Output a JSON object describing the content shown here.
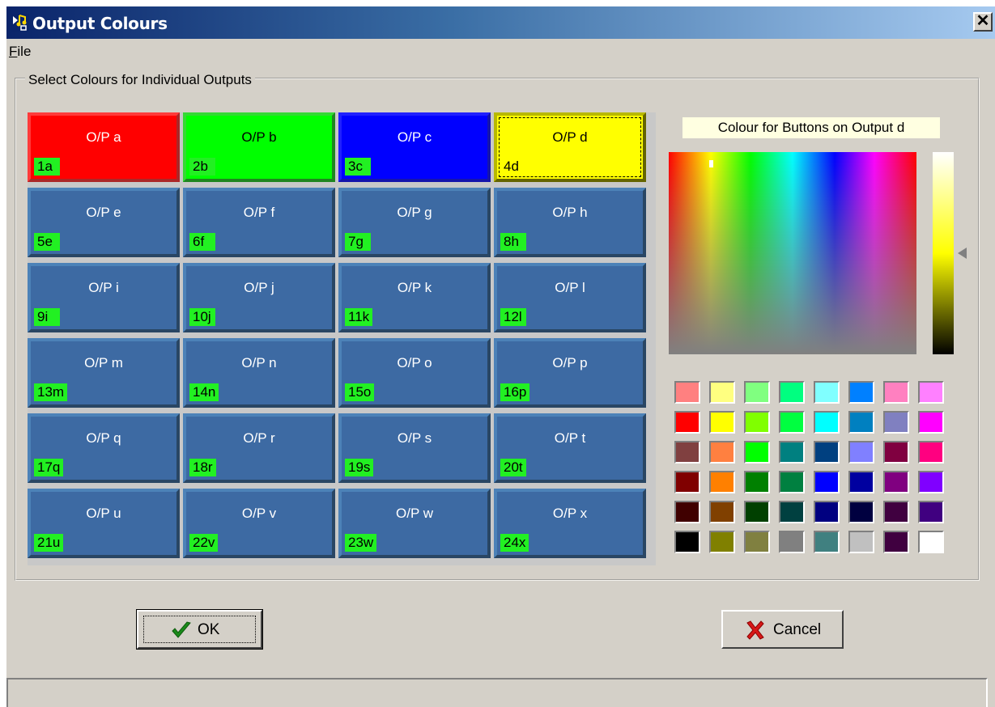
{
  "window": {
    "title": "Output Colours",
    "close_glyph": "✕"
  },
  "menu": {
    "file_accel": "F",
    "file_rest": "ile"
  },
  "group": {
    "label": "Select Colours for Individual Outputs"
  },
  "outputs": [
    {
      "label": "O/P a",
      "key": "1a",
      "color": "#ff0000"
    },
    {
      "label": "O/P b",
      "key": "2b",
      "color": "#00ff00"
    },
    {
      "label": "O/P c",
      "key": "3c",
      "color": "#0000ff"
    },
    {
      "label": "O/P d",
      "key": "4d",
      "color": "#ffff00",
      "focused": true
    },
    {
      "label": "O/P e",
      "key": "5e"
    },
    {
      "label": "O/P f",
      "key": "6f"
    },
    {
      "label": "O/P g",
      "key": "7g"
    },
    {
      "label": "O/P h",
      "key": "8h"
    },
    {
      "label": "O/P i",
      "key": "9i"
    },
    {
      "label": "O/P j",
      "key": "10j"
    },
    {
      "label": "O/P k",
      "key": "11k"
    },
    {
      "label": "O/P l",
      "key": "12l"
    },
    {
      "label": "O/P m",
      "key": "13m"
    },
    {
      "label": "O/P n",
      "key": "14n"
    },
    {
      "label": "O/P o",
      "key": "15o"
    },
    {
      "label": "O/P p",
      "key": "16p"
    },
    {
      "label": "O/P q",
      "key": "17q"
    },
    {
      "label": "O/P r",
      "key": "18r"
    },
    {
      "label": "O/P s",
      "key": "19s"
    },
    {
      "label": "O/P t",
      "key": "20t"
    },
    {
      "label": "O/P u",
      "key": "21u"
    },
    {
      "label": "O/P v",
      "key": "22v"
    },
    {
      "label": "O/P w",
      "key": "23w"
    },
    {
      "label": "O/P x",
      "key": "24x"
    }
  ],
  "colors": {
    "default_button": "#3d6aa3",
    "key_badge": "#22f022"
  },
  "picker": {
    "caption": "Colour for Buttons on Output d",
    "palette": [
      "#ff8080",
      "#ffff80",
      "#80ff80",
      "#00ff80",
      "#80ffff",
      "#0080ff",
      "#ff80c0",
      "#ff80ff",
      "#ff0000",
      "#ffff00",
      "#80ff00",
      "#00ff40",
      "#00ffff",
      "#0080c0",
      "#8080c0",
      "#ff00ff",
      "#804040",
      "#ff8040",
      "#00ff00",
      "#008080",
      "#004080",
      "#8080ff",
      "#800040",
      "#ff0080",
      "#800000",
      "#ff8000",
      "#008000",
      "#008040",
      "#0000ff",
      "#0000a0",
      "#800080",
      "#8000ff",
      "#400000",
      "#804000",
      "#004000",
      "#004040",
      "#000080",
      "#000040",
      "#400040",
      "#400080",
      "#000000",
      "#808000",
      "#808040",
      "#808080",
      "#408080",
      "#c0c0c0",
      "#400040",
      "#ffffff"
    ]
  },
  "buttons": {
    "ok": "OK",
    "cancel": "Cancel"
  }
}
